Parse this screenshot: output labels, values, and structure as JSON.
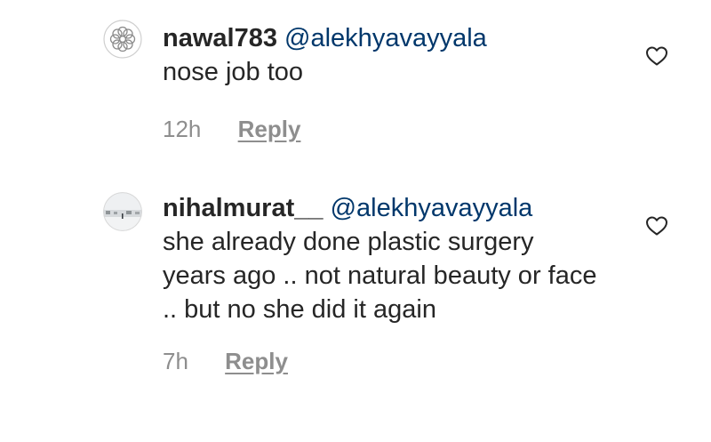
{
  "comments": [
    {
      "username": "nawal783",
      "mention": "@alekhyavayyala",
      "text": "nose job too",
      "time": "12h",
      "reply_label": "Reply",
      "avatar_icon": "flower-outline-avatar",
      "like_icon": "heart-outline-icon"
    },
    {
      "username": "nihalmurat__",
      "mention": "@alekhyavayyala",
      "text": "she already done plastic surgery years ago .. not natural beauty or face .. but no she did it again",
      "time": "7h",
      "reply_label": "Reply",
      "avatar_icon": "snowy-landscape-avatar",
      "like_icon": "heart-outline-icon"
    }
  ],
  "colors": {
    "text": "#262626",
    "mention": "#00376b",
    "secondary": "#8e8e8e"
  }
}
